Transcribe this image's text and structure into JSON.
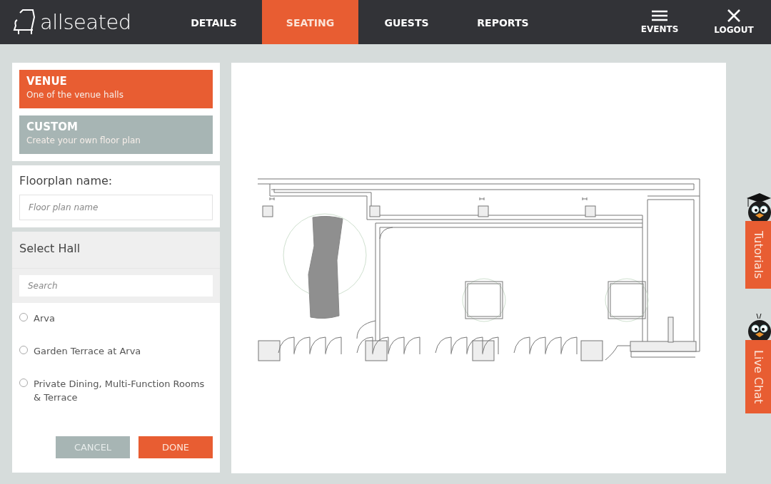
{
  "header": {
    "logo": "allseated",
    "nav": [
      {
        "label": "DETAILS",
        "selected": false
      },
      {
        "label": "SEATING",
        "selected": true
      },
      {
        "label": "GUESTS",
        "selected": false
      },
      {
        "label": "REPORTS",
        "selected": false
      }
    ],
    "actions": [
      {
        "kind": "menu",
        "label": "EVENTS"
      },
      {
        "kind": "close",
        "label": "LOGOUT"
      }
    ]
  },
  "plan_types": [
    {
      "title": "VENUE",
      "subtitle": "One of the venue halls",
      "selected": true
    },
    {
      "title": "CUSTOM",
      "subtitle": "Create your own floor plan",
      "selected": false
    }
  ],
  "floorplan_name": {
    "label": "Floorplan name:",
    "placeholder": "Floor plan name"
  },
  "select_hall": {
    "title": "Select Hall",
    "search_placeholder": "Search",
    "halls": [
      {
        "label": "Arva",
        "selected": false
      },
      {
        "label": "Garden Terrace at Arva",
        "selected": false
      },
      {
        "label": "Private Dining, Multi-Function Rooms & Terrace",
        "selected": false
      }
    ]
  },
  "buttons": [
    {
      "kind": "secondary",
      "label": "CANCEL"
    },
    {
      "kind": "primary",
      "label": "DONE"
    }
  ],
  "side_tabs": [
    {
      "kind": "graduate",
      "label": "Tutorials"
    },
    {
      "kind": "plain",
      "label": "Live Chat"
    }
  ]
}
